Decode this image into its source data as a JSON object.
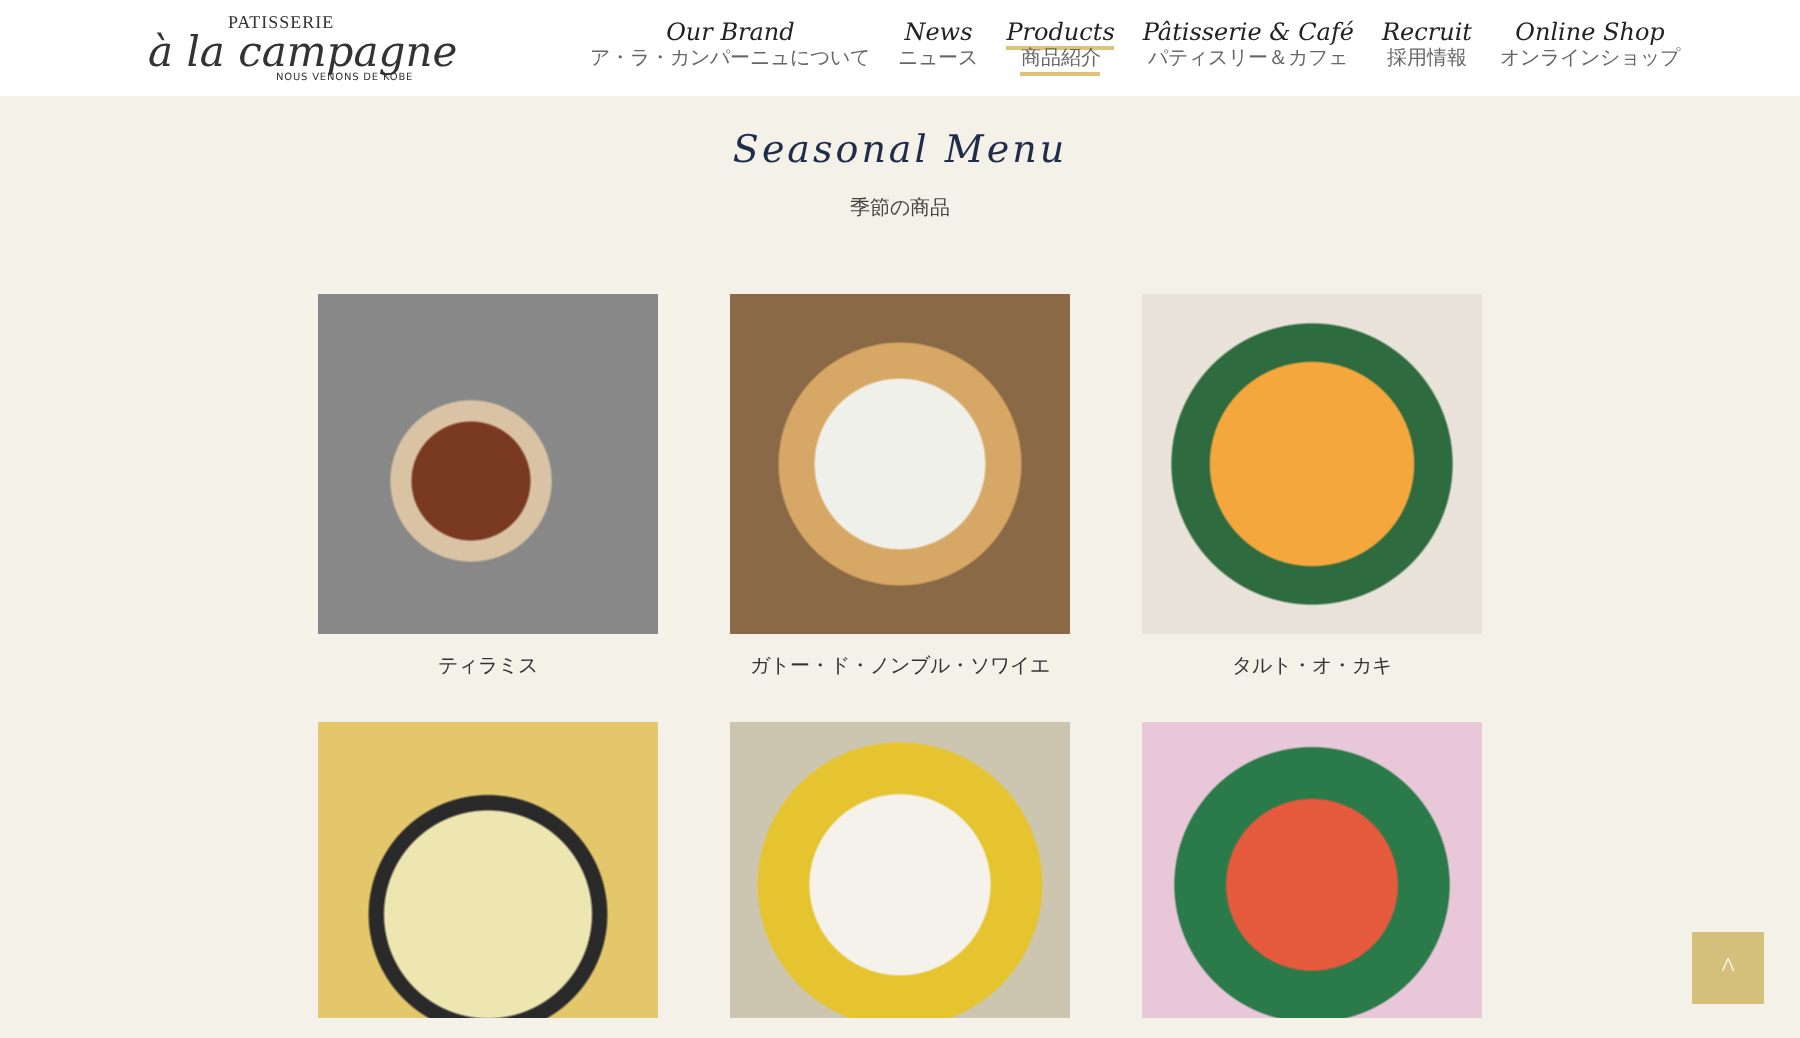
{
  "logo": {
    "top": "PATISSERIE",
    "main": "à la campagne",
    "tagline": "NOUS VENONS DE KOBE"
  },
  "nav": [
    {
      "label": "Our Brand",
      "sub": "ア・ラ・カンパーニュについて",
      "selected": false
    },
    {
      "label": "News",
      "sub": "ニュース",
      "selected": false
    },
    {
      "label": "Products",
      "sub": "商品紹介",
      "selected": true
    },
    {
      "label": "Pâtisserie & Café",
      "sub": "パティスリー＆カフェ",
      "selected": false
    },
    {
      "label": "Recruit",
      "sub": "採用情報",
      "selected": false
    },
    {
      "label": "Online Shop",
      "sub": "オンラインショップ",
      "selected": false
    }
  ],
  "section": {
    "title": "Seasonal Menu",
    "subtitle": "季節の商品"
  },
  "products": [
    {
      "kind": "captioned",
      "name": "ティラミス"
    },
    {
      "kind": "captioned",
      "name": "ガトー・ド・ノンブル・ソワイエ"
    },
    {
      "kind": "captioned",
      "name": "タルト・オ・カキ"
    },
    {
      "kind": "photo"
    },
    {
      "kind": "photo"
    },
    {
      "kind": "photo"
    }
  ],
  "back_to_top": {
    "label": "^"
  }
}
